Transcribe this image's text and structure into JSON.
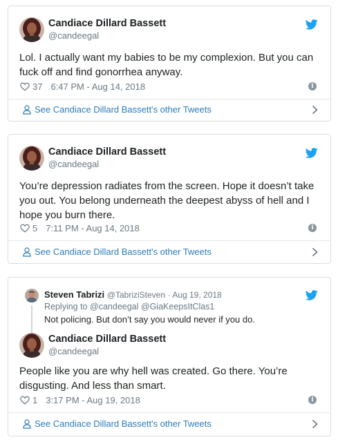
{
  "tweets": [
    {
      "name": "Candiace Dillard Bassett",
      "handle": "@candeegal",
      "text": "Lol. I actually want my babies to be my complexion. But you can fuck off and find gonorrhea anyway.",
      "likes": "37",
      "time": "6:47 PM - Aug 14, 2018",
      "more_label": "See Candiace Dillard Bassett's other Tweets"
    },
    {
      "name": "Candiace Dillard Bassett",
      "handle": "@candeegal",
      "text": "You’re depression radiates from the screen. Hope it doesn’t take you out. You belong underneath the deepest abyss of hell and I hope you burn there.",
      "likes": "5",
      "time": "7:11 PM - Aug 14, 2018",
      "more_label": "See Candiace Dillard Bassett's other Tweets"
    },
    {
      "reply_to": {
        "name": "Steven Tabrizi",
        "handle": "@TabriziSteven",
        "date": "· Aug 19, 2018",
        "replying_label": "Replying to",
        "replying_handles": "@candeegal @GiaKeepsItClas1",
        "text": "Not policing. But don’t say you would never if you do."
      },
      "name": "Candiace Dillard Bassett",
      "handle": "@candeegal",
      "text": "People like you are why hell was created. Go there. You’re disgusting. And less than smart.",
      "likes": "1",
      "time": "3:17 PM - Aug 19, 2018",
      "more_label": "See Candiace Dillard Bassett's other Tweets"
    }
  ],
  "colors": {
    "brand": "#1da1f2",
    "link": "#2b7bb9",
    "muted": "#697882"
  },
  "icons": [
    "twitter-bird-icon",
    "heart-icon",
    "info-icon",
    "person-icon",
    "chevron-right-icon"
  ]
}
